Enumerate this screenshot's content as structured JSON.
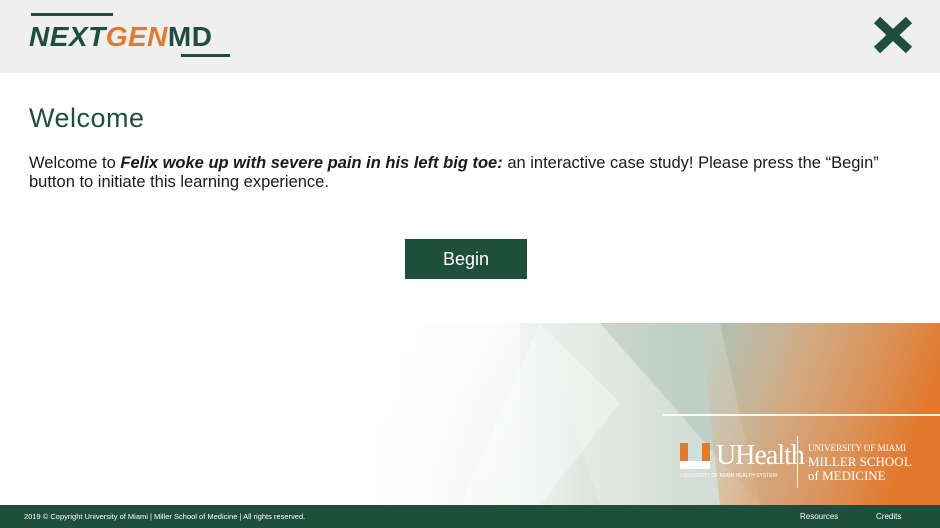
{
  "header": {
    "logo": {
      "part1": "NEXT",
      "part2": "GEN",
      "part3": "MD"
    },
    "close_icon": "close-x-icon"
  },
  "main": {
    "title": "Welcome",
    "intro_prefix": "Welcome to ",
    "case_title": "Felix woke up with severe pain in his left big toe:",
    "intro_suffix": " an interactive case study! Please press the “Begin” button to initiate this learning experience.",
    "begin_label": "Begin"
  },
  "banner": {
    "uhealth_label": "UHealth",
    "uhealth_sub": "UNIVERSITY OF MIAMI HEALTH SYSTEM",
    "um_line1": "UNIVERSITY OF MIAMI",
    "um_line2": "MILLER SCHOOL",
    "um_line3": "of MEDICINE"
  },
  "footer": {
    "copyright": "2019 © Copyright University of Miami | Miller School of Medicine | All rights reserved.",
    "resources_label": "Resources",
    "credits_label": "Credits"
  },
  "colors": {
    "brand_green": "#1f4e3d",
    "brand_orange": "#e07a2e",
    "header_bg": "#efefef"
  }
}
